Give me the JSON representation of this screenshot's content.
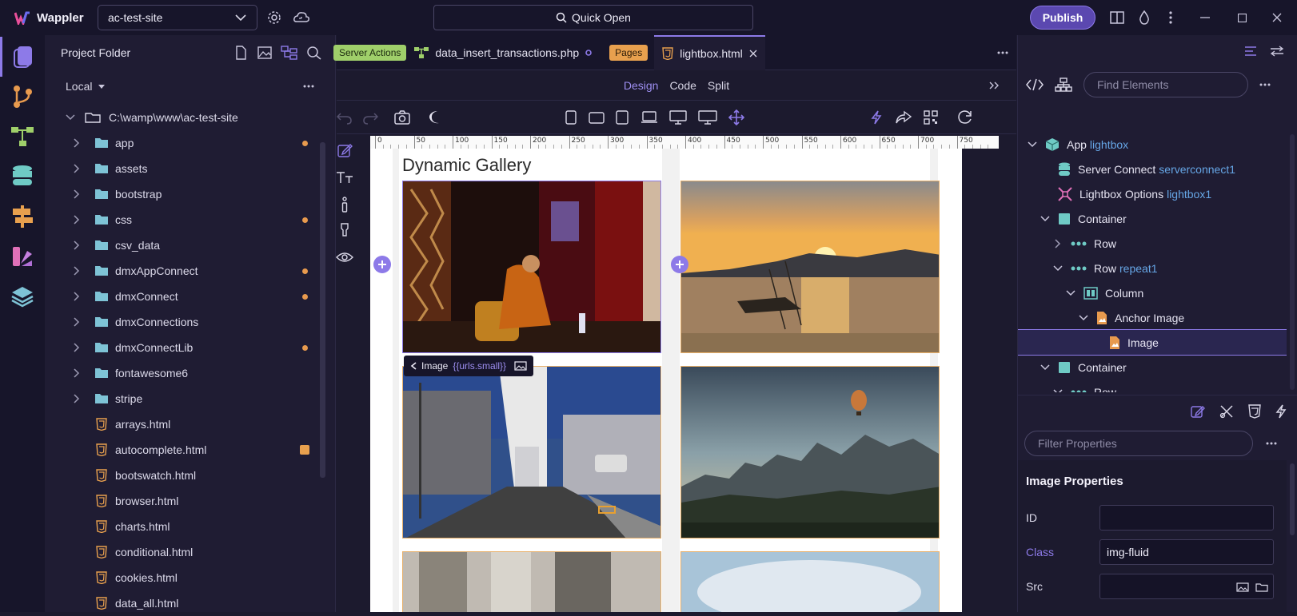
{
  "app": {
    "name": "Wappler",
    "site": "ac-test-site",
    "quick_open": "Quick Open",
    "publish": "Publish"
  },
  "project": {
    "title": "Project Folder",
    "location": "Local",
    "root": "C:\\wamp\\www\\ac-test-site",
    "folders": [
      {
        "name": "app",
        "modified": true
      },
      {
        "name": "assets",
        "modified": false
      },
      {
        "name": "bootstrap",
        "modified": false
      },
      {
        "name": "css",
        "modified": true
      },
      {
        "name": "csv_data",
        "modified": false
      },
      {
        "name": "dmxAppConnect",
        "modified": true
      },
      {
        "name": "dmxConnect",
        "modified": true
      },
      {
        "name": "dmxConnections",
        "modified": false
      },
      {
        "name": "dmxConnectLib",
        "modified": true
      },
      {
        "name": "fontawesome6",
        "modified": false
      },
      {
        "name": "stripe",
        "modified": false
      }
    ],
    "files": [
      "arrays.html",
      "autocomplete.html",
      "bootswatch.html",
      "browser.html",
      "charts.html",
      "conditional.html",
      "cookies.html",
      "data_all.html"
    ]
  },
  "tabs": [
    {
      "pill": "Server Actions",
      "label": "data_insert_transactions.php"
    },
    {
      "pill": "Pages",
      "label": "lightbox.html"
    }
  ],
  "views": {
    "design": "Design",
    "code": "Code",
    "split": "Split"
  },
  "ruler_ticks": [
    "0",
    "50",
    "100",
    "150",
    "200",
    "250",
    "300",
    "350",
    "400",
    "450",
    "500",
    "550",
    "600",
    "650",
    "700",
    "750"
  ],
  "canvas": {
    "title": "Dynamic Gallery",
    "image_tooltip_label": "Image",
    "image_tooltip_binding": "{{urls.small}}"
  },
  "elements": {
    "search_placeholder": "Find Elements",
    "tree": [
      {
        "label": "App",
        "id": "lightbox",
        "indent": 0,
        "expand": "open",
        "icon": "app-cube-icon"
      },
      {
        "label": "Server Connect",
        "id": "serverconnect1",
        "indent": 1,
        "expand": "none",
        "icon": "database-icon"
      },
      {
        "label": "Lightbox Options",
        "id": "lightbox1",
        "indent": 1,
        "expand": "none",
        "icon": "lightbox-icon"
      },
      {
        "label": "Container",
        "id": "",
        "indent": 1,
        "expand": "open",
        "icon": "container-icon"
      },
      {
        "label": "Row",
        "id": "",
        "indent": 2,
        "expand": "closed",
        "icon": "row-icon"
      },
      {
        "label": "Row",
        "id": "repeat1",
        "indent": 2,
        "expand": "open",
        "icon": "row-icon"
      },
      {
        "label": "Column",
        "id": "",
        "indent": 3,
        "expand": "open",
        "icon": "column-icon"
      },
      {
        "label": "Anchor Image",
        "id": "",
        "indent": 4,
        "expand": "open",
        "icon": "image-file-icon"
      },
      {
        "label": "Image",
        "id": "",
        "indent": 5,
        "expand": "none",
        "icon": "image-file-icon",
        "selected": true
      },
      {
        "label": "Container",
        "id": "",
        "indent": 1,
        "expand": "open",
        "icon": "container-icon"
      },
      {
        "label": "Row",
        "id": "",
        "indent": 2,
        "expand": "open",
        "icon": "row-icon"
      }
    ]
  },
  "properties": {
    "filter_placeholder": "Filter Properties",
    "title": "Image Properties",
    "id_label": "ID",
    "id_value": "",
    "class_label": "Class",
    "class_value": "img-fluid",
    "src_label": "Src",
    "src_value": ""
  },
  "colors": {
    "accent": "#8d7ae8",
    "orange": "#e89a4e",
    "folder": "#7ec3d6",
    "link_blue": "#66a6e6"
  }
}
